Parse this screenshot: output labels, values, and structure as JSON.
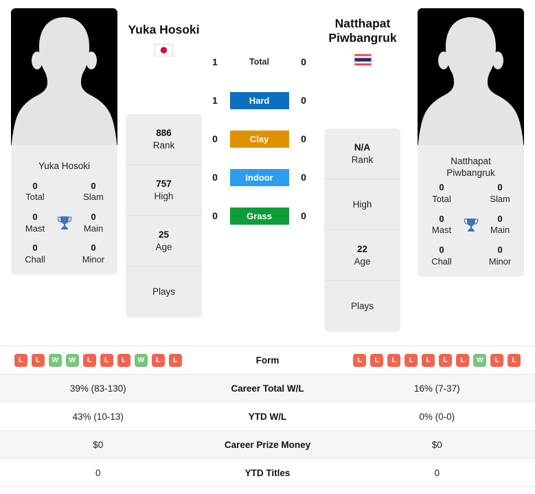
{
  "players": {
    "left": {
      "name": "Yuka Hosoki",
      "panel_name": "Yuka Hosoki",
      "flag": "japan-flag",
      "rank": "886",
      "rank_label": "Rank",
      "high": "757",
      "high_label": "High",
      "age": "25",
      "age_label": "Age",
      "plays": "Plays",
      "plays_value": "",
      "titles": {
        "total": "0",
        "total_label": "Total",
        "slam": "0",
        "slam_label": "Slam",
        "mast": "0",
        "mast_label": "Mast",
        "main": "0",
        "main_label": "Main",
        "chall": "0",
        "chall_label": "Chall",
        "minor": "0",
        "minor_label": "Minor"
      }
    },
    "right": {
      "name_line1": "Natthapat",
      "name_line2": "Piwbangruk",
      "panel_name_line1": "Natthapat",
      "panel_name_line2": "Piwbangruk",
      "flag": "thailand-flag",
      "rank": "N/A",
      "rank_label": "Rank",
      "high": "",
      "high_label": "High",
      "age": "22",
      "age_label": "Age",
      "plays": "Plays",
      "plays_value": "",
      "titles": {
        "total": "0",
        "total_label": "Total",
        "slam": "0",
        "slam_label": "Slam",
        "mast": "0",
        "mast_label": "Mast",
        "main": "0",
        "main_label": "Main",
        "chall": "0",
        "chall_label": "Chall",
        "minor": "0",
        "minor_label": "Minor"
      }
    }
  },
  "head_to_head": [
    {
      "label": "Total",
      "left": "1",
      "right": "0",
      "style": "plain",
      "color": ""
    },
    {
      "label": "Hard",
      "left": "1",
      "right": "0",
      "style": "badge",
      "color": "#0d6fbf"
    },
    {
      "label": "Clay",
      "left": "0",
      "right": "0",
      "style": "badge",
      "color": "#e09100"
    },
    {
      "label": "Indoor",
      "left": "0",
      "right": "0",
      "style": "badge",
      "color": "#2c9cf0"
    },
    {
      "label": "Grass",
      "left": "0",
      "right": "0",
      "style": "badge",
      "color": "#0f9d3a"
    }
  ],
  "stats": {
    "form": {
      "label": "Form",
      "left": [
        "L",
        "L",
        "W",
        "W",
        "L",
        "L",
        "L",
        "W",
        "L",
        "L"
      ],
      "right": [
        "L",
        "L",
        "L",
        "L",
        "L",
        "L",
        "L",
        "W",
        "L",
        "L"
      ]
    },
    "rows": [
      {
        "label": "Career Total W/L",
        "left": "39% (83-130)",
        "right": "16% (7-37)"
      },
      {
        "label": "YTD W/L",
        "left": "43% (10-13)",
        "right": "0% (0-0)"
      },
      {
        "label": "Career Prize Money",
        "left": "$0",
        "right": "$0"
      },
      {
        "label": "YTD Titles",
        "left": "0",
        "right": "0"
      }
    ]
  },
  "colors": {
    "win_badge": "#7ac47e",
    "loss_badge": "#f06450",
    "trophy": "#3f72b5",
    "card_bg": "#ededed",
    "alt_row": "#f5f5f5"
  }
}
